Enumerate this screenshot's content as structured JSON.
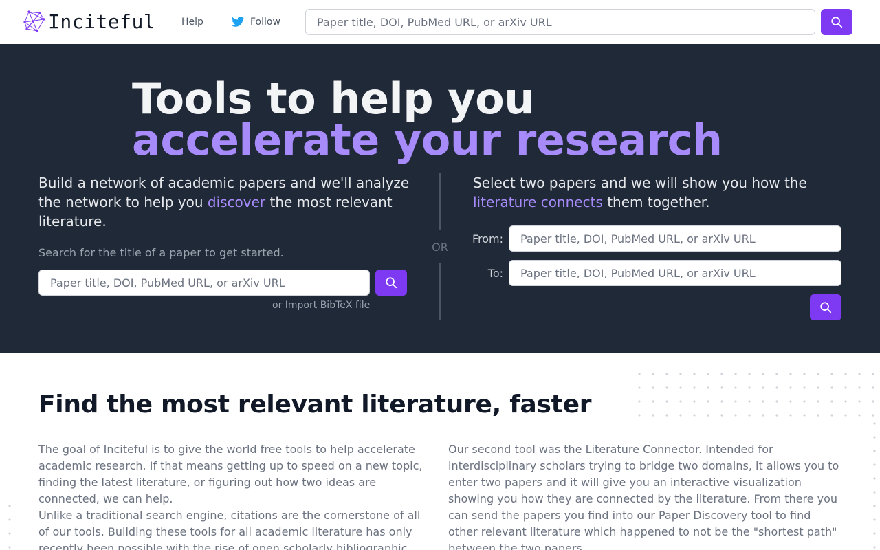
{
  "header": {
    "logo_text": "Inciteful",
    "help_label": "Help",
    "follow_label": "Follow",
    "search_placeholder": "Paper title, DOI, PubMed URL, or arXiv URL"
  },
  "hero": {
    "title_line1": "Tools to help you",
    "title_line2": "accelerate your research",
    "left": {
      "desc_part1": "Build a network of academic papers and we'll analyze the network to help you ",
      "desc_accent": "discover",
      "desc_part2": " the most relevant literature.",
      "hint": "Search for the title of a paper to get started.",
      "search_placeholder": "Paper title, DOI, PubMed URL, or arXiv URL",
      "import_prefix": "or ",
      "import_link": "Import BibTeX file"
    },
    "or_label": "OR",
    "right": {
      "desc_part1": "Select two papers and we will show you how the ",
      "desc_accent": "literature connects",
      "desc_part2": " them together.",
      "from_label": "From:",
      "to_label": "To:",
      "from_placeholder": "Paper title, DOI, PubMed URL, or arXiv URL",
      "to_placeholder": "Paper title, DOI, PubMed URL, or arXiv URL"
    }
  },
  "about": {
    "title": "Find the most relevant literature, faster",
    "col1_p1": "The goal of Inciteful is to give the world free tools to help accelerate academic research. If that means getting up to speed on a new topic, finding the latest literature, or figuring out how two ideas are connected, we can help.",
    "col1_p2": "Unlike a traditional search engine, citations are the cornerstone of all of our tools. Building these tools for all academic literature has only recently been possible with the rise of open scholarly bibliographic",
    "col2_p1": "Our second tool was the Literature Connector. Intended for interdisciplinary scholars trying to bridge two domains, it allows you to enter two papers and it will give you an interactive visualization showing you how they are connected by the literature. From there you can send the papers you find into our Paper Discovery tool to find other relevant literature which happened to not be the \"shortest path\" between the two papers."
  },
  "colors": {
    "accent": "#7e3af2",
    "accent_light": "#a78bfa",
    "hero_bg": "#1f2937",
    "twitter": "#1da1f2"
  },
  "icons": [
    "inciteful-logo-icon",
    "twitter-icon",
    "search-icon"
  ]
}
